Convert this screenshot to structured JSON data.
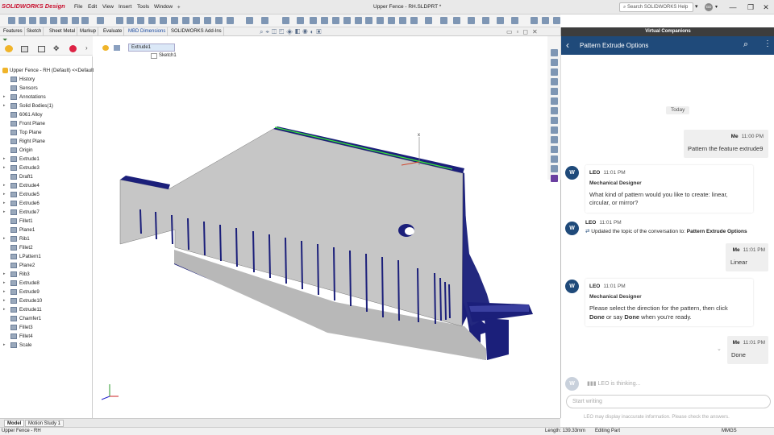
{
  "app": {
    "logo_text": "SOLIDWORKS Design",
    "title": "Upper Fence - RH.SLDPRT *",
    "menu": [
      "File",
      "Edit",
      "View",
      "Insert",
      "Tools",
      "Window"
    ],
    "search_placeholder": "Search SOLIDWORKS Help",
    "avatar": "GD",
    "window_controls": [
      "—",
      "❐",
      "✕",
      "—",
      "❐",
      "✕"
    ]
  },
  "command_tabs": [
    "Features",
    "Sketch",
    "Sheet Metal",
    "Markup",
    "Evaluate",
    "MBD Dimensions",
    "SOLIDWORKS Add-Ins"
  ],
  "tree": {
    "root": "Upper Fence - RH (Default) <<Default>",
    "items": [
      {
        "label": "History",
        "expandable": false
      },
      {
        "label": "Sensors",
        "expandable": false
      },
      {
        "label": "Annotations",
        "expandable": true
      },
      {
        "label": "Solid Bodies(1)",
        "expandable": true
      },
      {
        "label": "6061 Alloy",
        "expandable": false
      },
      {
        "label": "Front Plane",
        "expandable": false
      },
      {
        "label": "Top Plane",
        "expandable": false
      },
      {
        "label": "Right Plane",
        "expandable": false
      },
      {
        "label": "Origin",
        "expandable": false
      },
      {
        "label": "Extrude1",
        "expandable": true
      },
      {
        "label": "Extrude3",
        "expandable": true
      },
      {
        "label": "Draft1",
        "expandable": false
      },
      {
        "label": "Extrude4",
        "expandable": true
      },
      {
        "label": "Extrude5",
        "expandable": true
      },
      {
        "label": "Extrude6",
        "expandable": true
      },
      {
        "label": "Extrude7",
        "expandable": true
      },
      {
        "label": "Fillet1",
        "expandable": false
      },
      {
        "label": "Plane1",
        "expandable": false
      },
      {
        "label": "Rib1",
        "expandable": true
      },
      {
        "label": "Fillet2",
        "expandable": false
      },
      {
        "label": "LPattern1",
        "expandable": false
      },
      {
        "label": "Plane2",
        "expandable": false
      },
      {
        "label": "Rib3",
        "expandable": true
      },
      {
        "label": "Extrude8",
        "expandable": true
      },
      {
        "label": "Extrude9",
        "expandable": true
      },
      {
        "label": "Extrude10",
        "expandable": true
      },
      {
        "label": "Extrude11",
        "expandable": true
      },
      {
        "label": "Chamfer1",
        "expandable": false
      },
      {
        "label": "Fillet3",
        "expandable": false
      },
      {
        "label": "Fillet4",
        "expandable": false
      },
      {
        "label": "Scale",
        "expandable": true
      }
    ]
  },
  "breadcrumb": {
    "feature": "Extrude1",
    "sketch": "Sketch1"
  },
  "vc": {
    "panel_title": "Virtual Companions",
    "chat_title": "Pattern Extrude Options",
    "date_divider": "Today",
    "messages": [
      {
        "who": "Me",
        "time": "11:00 PM",
        "text": "Pattern the feature extrude9"
      },
      {
        "who": "LEO",
        "time": "11:01 PM",
        "role": "Mechanical Designer",
        "text": "What kind of pattern would you like to create: linear, circular, or mirror?"
      },
      {
        "who": "LEO",
        "time": "11:01 PM",
        "text_pre": "Updated the topic of the conversation to: ",
        "text_bold": "Pattern Extrude Options"
      },
      {
        "who": "Me",
        "time": "11:01 PM",
        "text": "Linear"
      },
      {
        "who": "LEO",
        "time": "11:01 PM",
        "role": "Mechanical Designer",
        "text_1": "Please select the direction for the pattern, then click",
        "text_2a": "Done",
        "text_2b": " or say ",
        "text_2c": "Done",
        "text_2d": " when you're ready."
      },
      {
        "who": "Me",
        "time": "11:01 PM",
        "text": "Done"
      }
    ],
    "thinking": "LEO is thinking...",
    "input_placeholder": "Start writing",
    "disclaimer": "LEO may display inaccurate information. Please check the answers."
  },
  "bottom_tabs": [
    "Model",
    "Motion Study 1"
  ],
  "status": {
    "left": "Upper Fence - RH",
    "length": "Length: 139.33mm",
    "mode": "Editing Part",
    "units": "MMGS"
  },
  "colors": {
    "accent": "#1f4a7a",
    "model_face": "#c8c8c8",
    "model_side": "#1b1f7a",
    "edge_highlight": "#38e03a"
  }
}
